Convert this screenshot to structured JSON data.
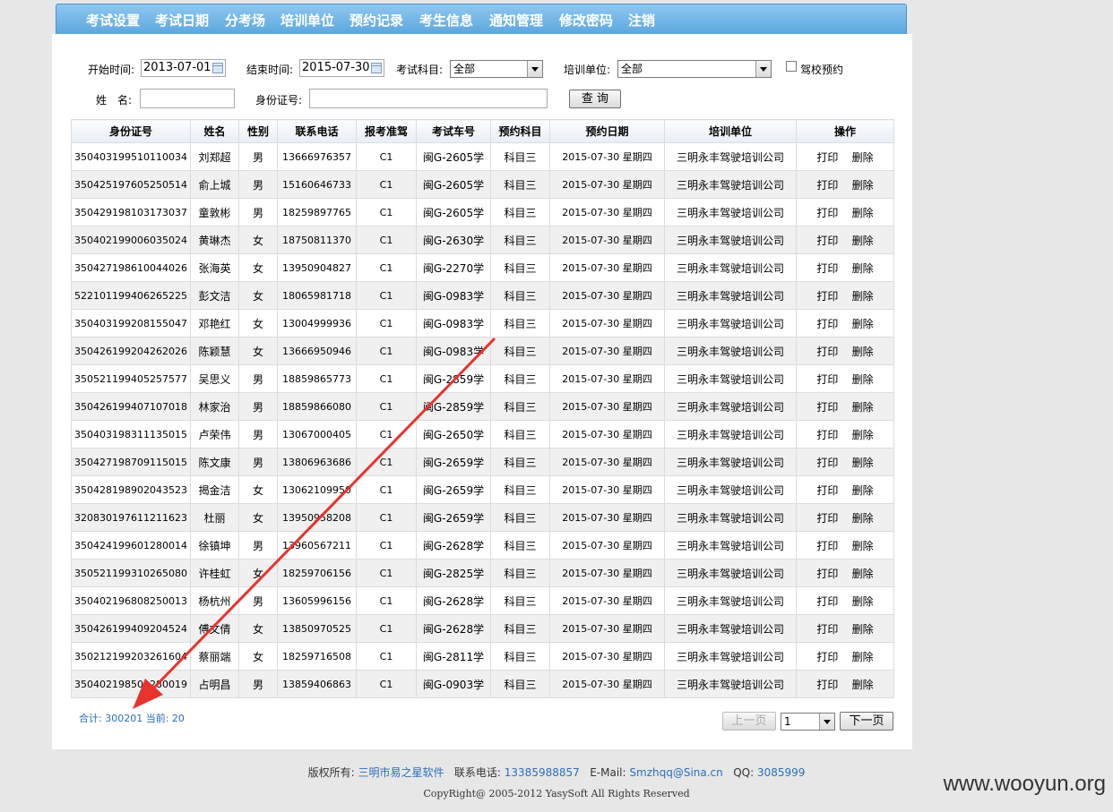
{
  "nav": [
    "考试设置",
    "考试日期",
    "分考场",
    "培训单位",
    "预约记录",
    "考生信息",
    "通知管理",
    "修改密码",
    "注销"
  ],
  "filters": {
    "start_label": "开始时间:",
    "start_value": "2013-07-01",
    "end_label": "结束时间:",
    "end_value": "2015-07-30",
    "subject_label": "考试科目:",
    "subject_value": "全部",
    "unit_label": "培训单位:",
    "unit_value": "全部",
    "school_label": "驾校预约",
    "name_label": "姓　名:",
    "name_value": "",
    "id_label": "身份证号:",
    "id_value": "",
    "query_button": "查 询"
  },
  "table": {
    "headers": [
      "身份证号",
      "姓名",
      "性别",
      "联系电话",
      "报考准驾",
      "考试车号",
      "预约科目",
      "预约日期",
      "培训单位",
      "操作"
    ],
    "print_label": "打印",
    "delete_label": "删除",
    "rows": [
      [
        "350403199510110034",
        "刘郑超",
        "男",
        "13666976357",
        "C1",
        "闽G-2605学",
        "科目三",
        "2015-07-30 星期四",
        "三明永丰驾驶培训公司"
      ],
      [
        "350425197605250514",
        "俞上城",
        "男",
        "15160646733",
        "C1",
        "闽G-2605学",
        "科目三",
        "2015-07-30 星期四",
        "三明永丰驾驶培训公司"
      ],
      [
        "350429198103173037",
        "童敦彬",
        "男",
        "18259897765",
        "C1",
        "闽G-2605学",
        "科目三",
        "2015-07-30 星期四",
        "三明永丰驾驶培训公司"
      ],
      [
        "350402199006035024",
        "黄琳杰",
        "女",
        "18750811370",
        "C1",
        "闽G-2630学",
        "科目三",
        "2015-07-30 星期四",
        "三明永丰驾驶培训公司"
      ],
      [
        "350427198610044026",
        "张海英",
        "女",
        "13950904827",
        "C1",
        "闽G-2270学",
        "科目三",
        "2015-07-30 星期四",
        "三明永丰驾驶培训公司"
      ],
      [
        "522101199406265225",
        "彭文洁",
        "女",
        "18065981718",
        "C1",
        "闽G-0983学",
        "科目三",
        "2015-07-30 星期四",
        "三明永丰驾驶培训公司"
      ],
      [
        "350403199208155047",
        "邓艳红",
        "女",
        "13004999936",
        "C1",
        "闽G-0983学",
        "科目三",
        "2015-07-30 星期四",
        "三明永丰驾驶培训公司"
      ],
      [
        "350426199204262026",
        "陈颖慧",
        "女",
        "13666950946",
        "C1",
        "闽G-0983学",
        "科目三",
        "2015-07-30 星期四",
        "三明永丰驾驶培训公司"
      ],
      [
        "350521199405257577",
        "吴思义",
        "男",
        "18859865773",
        "C1",
        "闽G-2859学",
        "科目三",
        "2015-07-30 星期四",
        "三明永丰驾驶培训公司"
      ],
      [
        "350426199407107018",
        "林家治",
        "男",
        "18859866080",
        "C1",
        "闽G-2859学",
        "科目三",
        "2015-07-30 星期四",
        "三明永丰驾驶培训公司"
      ],
      [
        "350403198311135015",
        "卢荣伟",
        "男",
        "13067000405",
        "C1",
        "闽G-2650学",
        "科目三",
        "2015-07-30 星期四",
        "三明永丰驾驶培训公司"
      ],
      [
        "350427198709115015",
        "陈文康",
        "男",
        "13806963686",
        "C1",
        "闽G-2659学",
        "科目三",
        "2015-07-30 星期四",
        "三明永丰驾驶培训公司"
      ],
      [
        "350428198902043523",
        "揭金洁",
        "女",
        "13062109950",
        "C1",
        "闽G-2659学",
        "科目三",
        "2015-07-30 星期四",
        "三明永丰驾驶培训公司"
      ],
      [
        "320830197611211623",
        "杜丽",
        "女",
        "13950958208",
        "C1",
        "闽G-2659学",
        "科目三",
        "2015-07-30 星期四",
        "三明永丰驾驶培训公司"
      ],
      [
        "350424199601280014",
        "徐镇坤",
        "男",
        "13960567211",
        "C1",
        "闽G-2628学",
        "科目三",
        "2015-07-30 星期四",
        "三明永丰驾驶培训公司"
      ],
      [
        "350521199310265080",
        "许桂虹",
        "女",
        "18259706156",
        "C1",
        "闽G-2825学",
        "科目三",
        "2015-07-30 星期四",
        "三明永丰驾驶培训公司"
      ],
      [
        "350402196808250013",
        "杨杭州",
        "男",
        "13605996156",
        "C1",
        "闽G-2628学",
        "科目三",
        "2015-07-30 星期四",
        "三明永丰驾驶培训公司"
      ],
      [
        "350426199409204524",
        "傅文倩",
        "女",
        "13850970525",
        "C1",
        "闽G-2628学",
        "科目三",
        "2015-07-30 星期四",
        "三明永丰驾驶培训公司"
      ],
      [
        "350212199203261604",
        "蔡丽端",
        "女",
        "18259716508",
        "C1",
        "闽G-2811学",
        "科目三",
        "2015-07-30 星期四",
        "三明永丰驾驶培训公司"
      ],
      [
        "350402198501280019",
        "占明昌",
        "男",
        "13859406863",
        "C1",
        "闽G-0903学",
        "科目三",
        "2015-07-30 星期四",
        "三明永丰驾驶培训公司"
      ]
    ]
  },
  "pager": {
    "summary": "合计: 300201 当前: 20",
    "prev_label": "上一页",
    "page_value": "1",
    "next_label": "下一页"
  },
  "footer": {
    "copyright_label": "版权所有:",
    "company": "三明市易之星软件",
    "phone_label": "联系电话:",
    "phone": "13385988857",
    "email_label": "E-Mail:",
    "email": "Smzhqq@Sina.cn",
    "qq_label": "QQ:",
    "qq": "3085999",
    "line2": "CopyRight@ 2005-2012  YasySoft All Rights Reserved"
  },
  "watermark": "www.wooyun.org",
  "annotation": {
    "arrow_color": "#e8332d"
  }
}
